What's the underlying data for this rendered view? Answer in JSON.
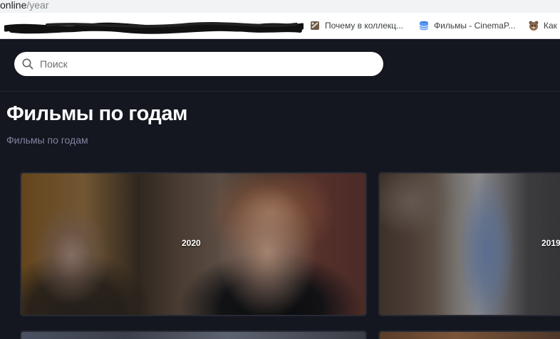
{
  "browser": {
    "url_host": "online",
    "url_path": "/year",
    "bookmarks": [
      {
        "label": "Почему в коллекц...",
        "icon": "bookmark-favicon-icon"
      },
      {
        "label": "Фильмы - CinemaP...",
        "icon": "database-favicon-icon"
      },
      {
        "label": "Как",
        "icon": "bear-favicon-icon"
      }
    ]
  },
  "header": {
    "search_placeholder": "Поиск"
  },
  "page": {
    "title": "Фильмы по годам",
    "breadcrumb": "Фильмы по годам"
  },
  "cards": [
    {
      "year": "2020"
    },
    {
      "year": "2019"
    }
  ],
  "colors": {
    "page_background": "#14171f",
    "title": "#ffffff",
    "breadcrumb": "#7f84a0",
    "search_background": "#ffffff"
  }
}
